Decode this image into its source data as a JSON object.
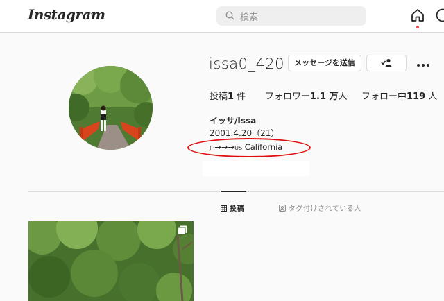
{
  "header": {
    "logo": "Instagram",
    "logo_chevron": "⌵",
    "search_placeholder": "検索",
    "icons": [
      "search-icon",
      "home-icon",
      "explore-icon"
    ],
    "notification_color": "#ed4956"
  },
  "profile": {
    "username": "issa0_420",
    "message_button": "メッセージを送信",
    "follow_button_icon": "person-check-icon",
    "more_icon": "•••",
    "stats": {
      "posts_label": "投稿",
      "posts_count": "1",
      "posts_unit": "件",
      "followers_label": "フォロワー",
      "followers_count": "1.1 万",
      "followers_unit": "人",
      "following_label": "フォロー中",
      "following_count": "119",
      "following_unit": "人"
    },
    "full_name": "イッサ/Issa",
    "bio_line1": "2001.4.20（21）",
    "bio_line2_flag1": "JP",
    "bio_line2_arrows": "→→→",
    "bio_line2_flag2": "US",
    "bio_line2_text": " California",
    "highlight_color": "#e10e0e"
  },
  "tabs": [
    {
      "label": "投稿",
      "icon": "grid-icon",
      "active": true
    },
    {
      "label": "タグ付けされている人",
      "icon": "tag-icon",
      "active": false
    }
  ],
  "posts": [
    {
      "type": "photo",
      "multi": true,
      "icon": "multiple-posts-icon"
    }
  ]
}
